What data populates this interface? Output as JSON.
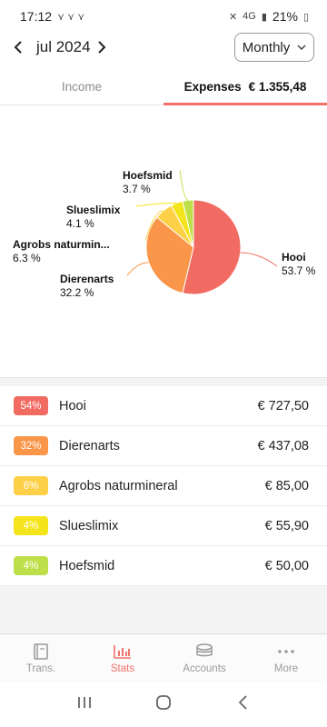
{
  "status_bar": {
    "time": "17:12",
    "network": "4G",
    "battery": "21%"
  },
  "header": {
    "month": "jul 2024",
    "period": "Monthly"
  },
  "tabs": [
    {
      "label": "Income",
      "amount": "",
      "active": false
    },
    {
      "label": "Expenses",
      "amount": "€ 1.355,48",
      "active": true
    }
  ],
  "chart_data": {
    "type": "pie",
    "slices": [
      {
        "label": "Hooi",
        "percent_label": "53.7 %",
        "value": 53.7,
        "color": "#f26b62"
      },
      {
        "label": "Dierenarts",
        "percent_label": "32.2 %",
        "value": 32.2,
        "color": "#f9964a"
      },
      {
        "label": "Agrobs naturmin...",
        "percent_label": "6.3 %",
        "value": 6.3,
        "color": "#fdd047"
      },
      {
        "label": "Slueslimix",
        "percent_label": "4.1 %",
        "value": 4.1,
        "color": "#f4e41b"
      },
      {
        "label": "Hoefsmid",
        "percent_label": "3.7 %",
        "value": 3.7,
        "color": "#bde04a"
      }
    ]
  },
  "list": [
    {
      "badge": "54%",
      "name": "Hooi",
      "amount": "€ 727,50",
      "color": "#f26b62"
    },
    {
      "badge": "32%",
      "name": "Dierenarts",
      "amount": "€ 437,08",
      "color": "#f9964a"
    },
    {
      "badge": "6%",
      "name": "Agrobs naturmineral",
      "amount": "€ 85,00",
      "color": "#fdd047"
    },
    {
      "badge": "4%",
      "name": "Slueslimix",
      "amount": "€ 55,90",
      "color": "#f4e41b"
    },
    {
      "badge": "4%",
      "name": "Hoefsmid",
      "amount": "€ 50,00",
      "color": "#bde04a"
    }
  ],
  "bottom_nav": [
    {
      "label": "Trans.",
      "icon": "book-icon",
      "active": false
    },
    {
      "label": "Stats",
      "icon": "bar-chart-icon",
      "active": true
    },
    {
      "label": "Accounts",
      "icon": "coins-icon",
      "active": false
    },
    {
      "label": "More",
      "icon": "more-dots-icon",
      "active": false
    }
  ]
}
